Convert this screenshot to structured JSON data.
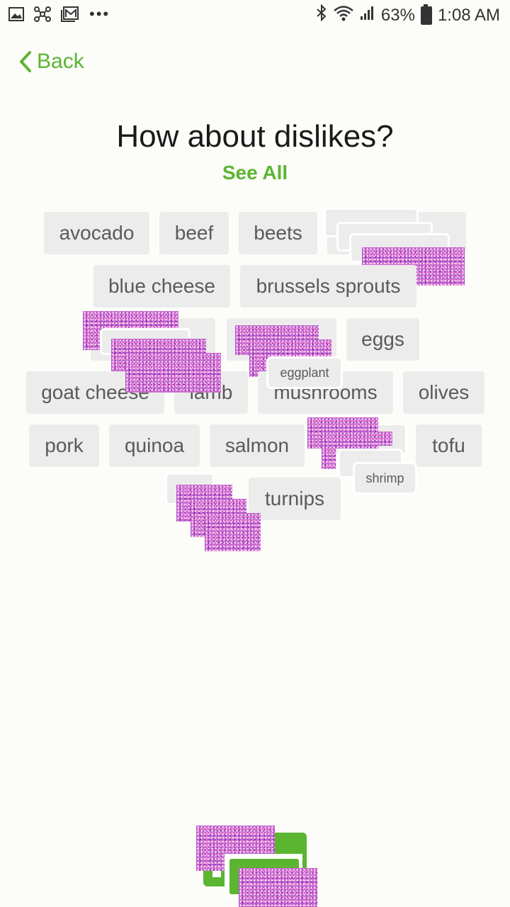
{
  "status_bar": {
    "battery": "63%",
    "time": "1:08 AM",
    "icons": [
      "image-icon",
      "network-icon",
      "mail-icon",
      "more-icon",
      "bluetooth-icon",
      "wifi-icon",
      "signal-icon",
      "battery-icon"
    ]
  },
  "nav": {
    "back_label": "Back"
  },
  "page": {
    "title": "How about dislikes?",
    "see_all": "See All"
  },
  "chips": {
    "avocado": "avocado",
    "beef": "beef",
    "beets": "beets",
    "blue_cheese": "blue cheese",
    "brussels_sprouts": "brussels sprouts",
    "eggs": "eggs",
    "eggplant": "eggplant",
    "goat_cheese": "goat cheese",
    "lamb": "lamb",
    "mushrooms": "mushrooms",
    "olives": "olives",
    "pork": "pork",
    "quinoa": "quinoa",
    "salmon": "salmon",
    "shrimp": "shrimp",
    "tofu": "tofu",
    "turnips": "turnips"
  },
  "colors": {
    "accent": "#5cb531",
    "chip_bg": "#ececec",
    "chip_text": "#5a5a5a",
    "background": "#fcfcf9"
  }
}
